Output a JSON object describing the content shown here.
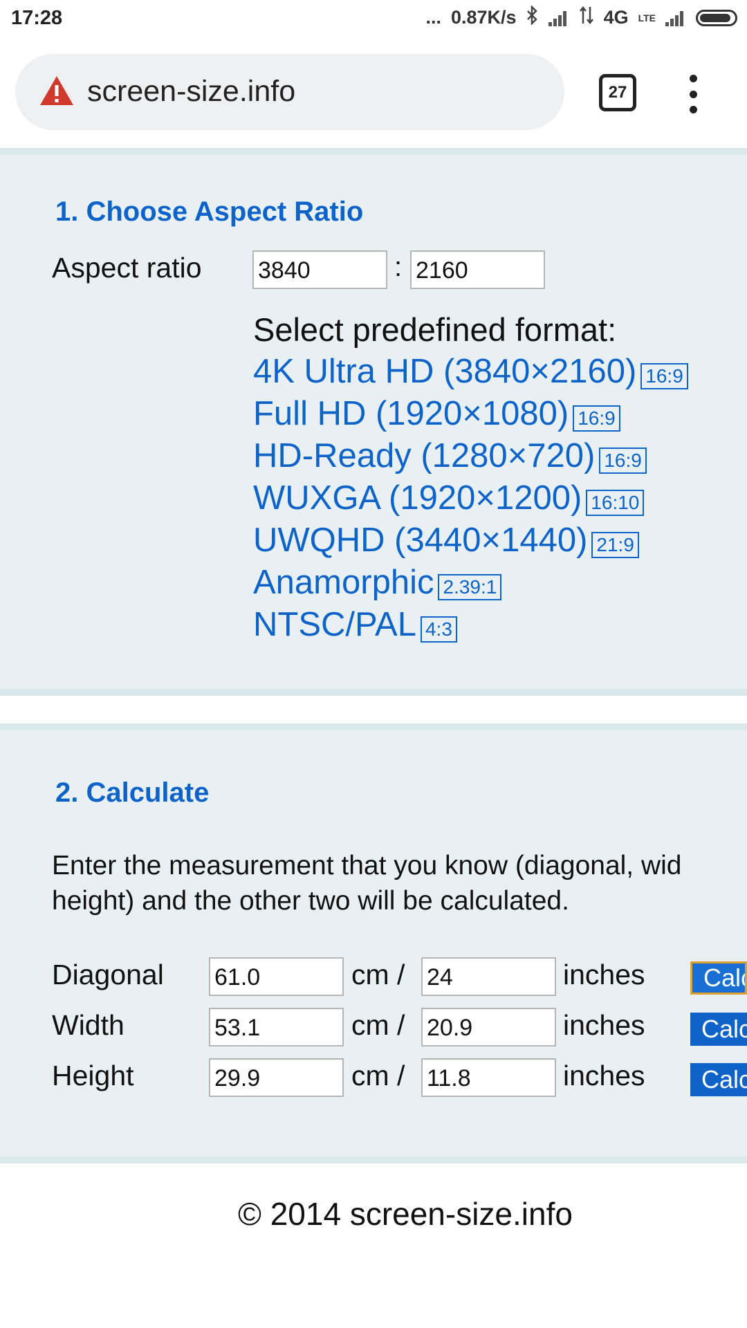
{
  "status_bar": {
    "time": "17:28",
    "dots": "...",
    "speed": "0.87K/s",
    "network": "4G",
    "lte": "LTE",
    "icons": [
      "bluetooth-icon",
      "signal-icon",
      "data-arrows-icon",
      "volte-icon",
      "signal-icon",
      "battery-icon"
    ]
  },
  "browser": {
    "url": "screen-size.info",
    "tab_count": "27",
    "security_icon": "warning-icon",
    "menu_icon": "overflow-menu-icon"
  },
  "section1": {
    "title": "1. Choose Aspect Ratio",
    "aspect_label": "Aspect ratio",
    "ratio_width": "3840",
    "ratio_separator": ":",
    "ratio_height": "2160",
    "predefined_heading": "Select predefined format:",
    "formats": [
      {
        "label": "4K Ultra HD (3840×2160)",
        "ratio": "16:9"
      },
      {
        "label": "Full HD (1920×1080)",
        "ratio": "16:9"
      },
      {
        "label": "HD-Ready (1280×720)",
        "ratio": "16:9"
      },
      {
        "label": "WUXGA (1920×1200)",
        "ratio": "16:10"
      },
      {
        "label": "UWQHD (3440×1440)",
        "ratio": "21:9"
      },
      {
        "label": "Anamorphic",
        "ratio": "2.39:1"
      },
      {
        "label": "NTSC/PAL",
        "ratio": "4:3"
      }
    ]
  },
  "section2": {
    "title": "2. Calculate",
    "description_line1": "Enter the measurement that you know (diagonal, wid",
    "description_line2": "height) and the other two will be calculated.",
    "rows": [
      {
        "label": "Diagonal",
        "cm": "61.0",
        "cm_unit": "cm /",
        "inches": "24",
        "inch_unit": "inches",
        "button": "Calc"
      },
      {
        "label": "Width",
        "cm": "53.1",
        "cm_unit": "cm /",
        "inches": "20.9",
        "inch_unit": "inches",
        "button": "Calc"
      },
      {
        "label": "Height",
        "cm": "29.9",
        "cm_unit": "cm /",
        "inches": "11.8",
        "inch_unit": "inches",
        "button": "Calc"
      }
    ]
  },
  "footer": {
    "copyright": "© 2014 screen-size.info"
  },
  "colors": {
    "link": "#0d63c8",
    "section_bg": "#e8f0f4",
    "warning": "#d0392b"
  }
}
